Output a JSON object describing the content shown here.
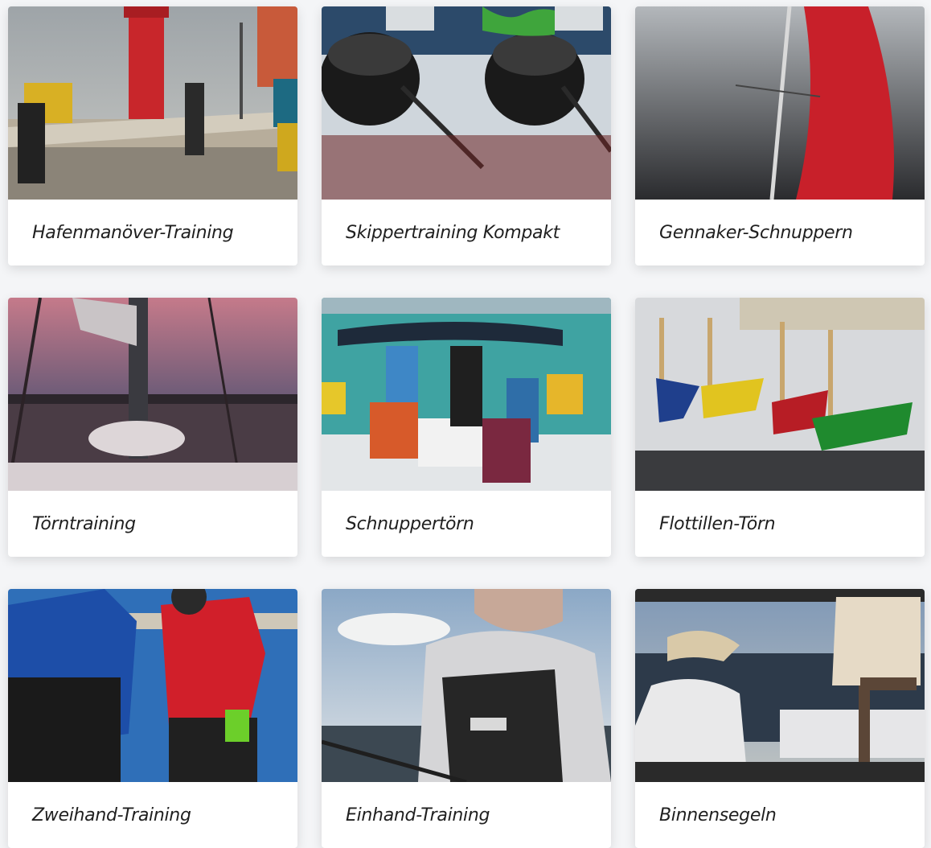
{
  "courses": [
    {
      "title": "Hafenmanöver-Training",
      "image": "harbor-lighthouse-photo"
    },
    {
      "title": "Skippertraining Kompakt",
      "image": "winch-photo"
    },
    {
      "title": "Gennaker-Schnuppern",
      "image": "red-sail-photo"
    },
    {
      "title": "Törntraining",
      "image": "sunset-marina-photo"
    },
    {
      "title": "Schnuppertörn",
      "image": "crew-on-deck-photo"
    },
    {
      "title": "Flottillen-Törn",
      "image": "toy-boats-photo"
    },
    {
      "title": "Zweihand-Training",
      "image": "two-sailors-photo"
    },
    {
      "title": "Einhand-Training",
      "image": "single-sailor-photo"
    },
    {
      "title": "Binnensegeln",
      "image": "lake-sailing-photo"
    }
  ],
  "colors": {
    "card_bg": "#ffffff",
    "page_bg": "#f4f5f7",
    "title_text": "#1f1f1f"
  }
}
